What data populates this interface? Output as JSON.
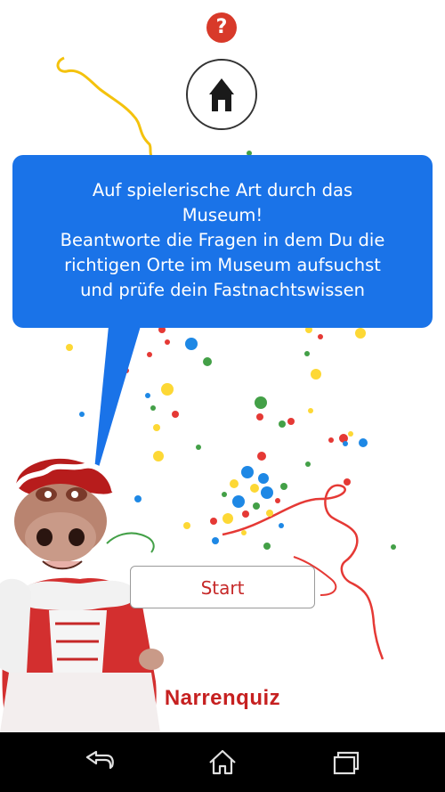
{
  "help": {
    "icon": "question-mark-icon",
    "label": "?"
  },
  "home": {
    "icon": "museum-home-icon"
  },
  "bubble": {
    "lines": [
      "Auf spielerische Art durch das",
      "Museum!",
      "Beantworte die Fragen in dem Du die",
      "richtigen Orte im Museum aufsuchst",
      "und prüfe dein Fastnachtswissen"
    ]
  },
  "start_button": {
    "label": "Start"
  },
  "app_title": "Narrenquiz",
  "navbar": {
    "back_icon": "back-arrow-icon",
    "home_icon": "home-outline-icon",
    "recents_icon": "recents-icon"
  },
  "colors": {
    "bubble": "#1a73e8",
    "accent_red": "#c62828",
    "confetti": [
      "#e53935",
      "#1e88e5",
      "#43a047",
      "#fdd835"
    ]
  }
}
